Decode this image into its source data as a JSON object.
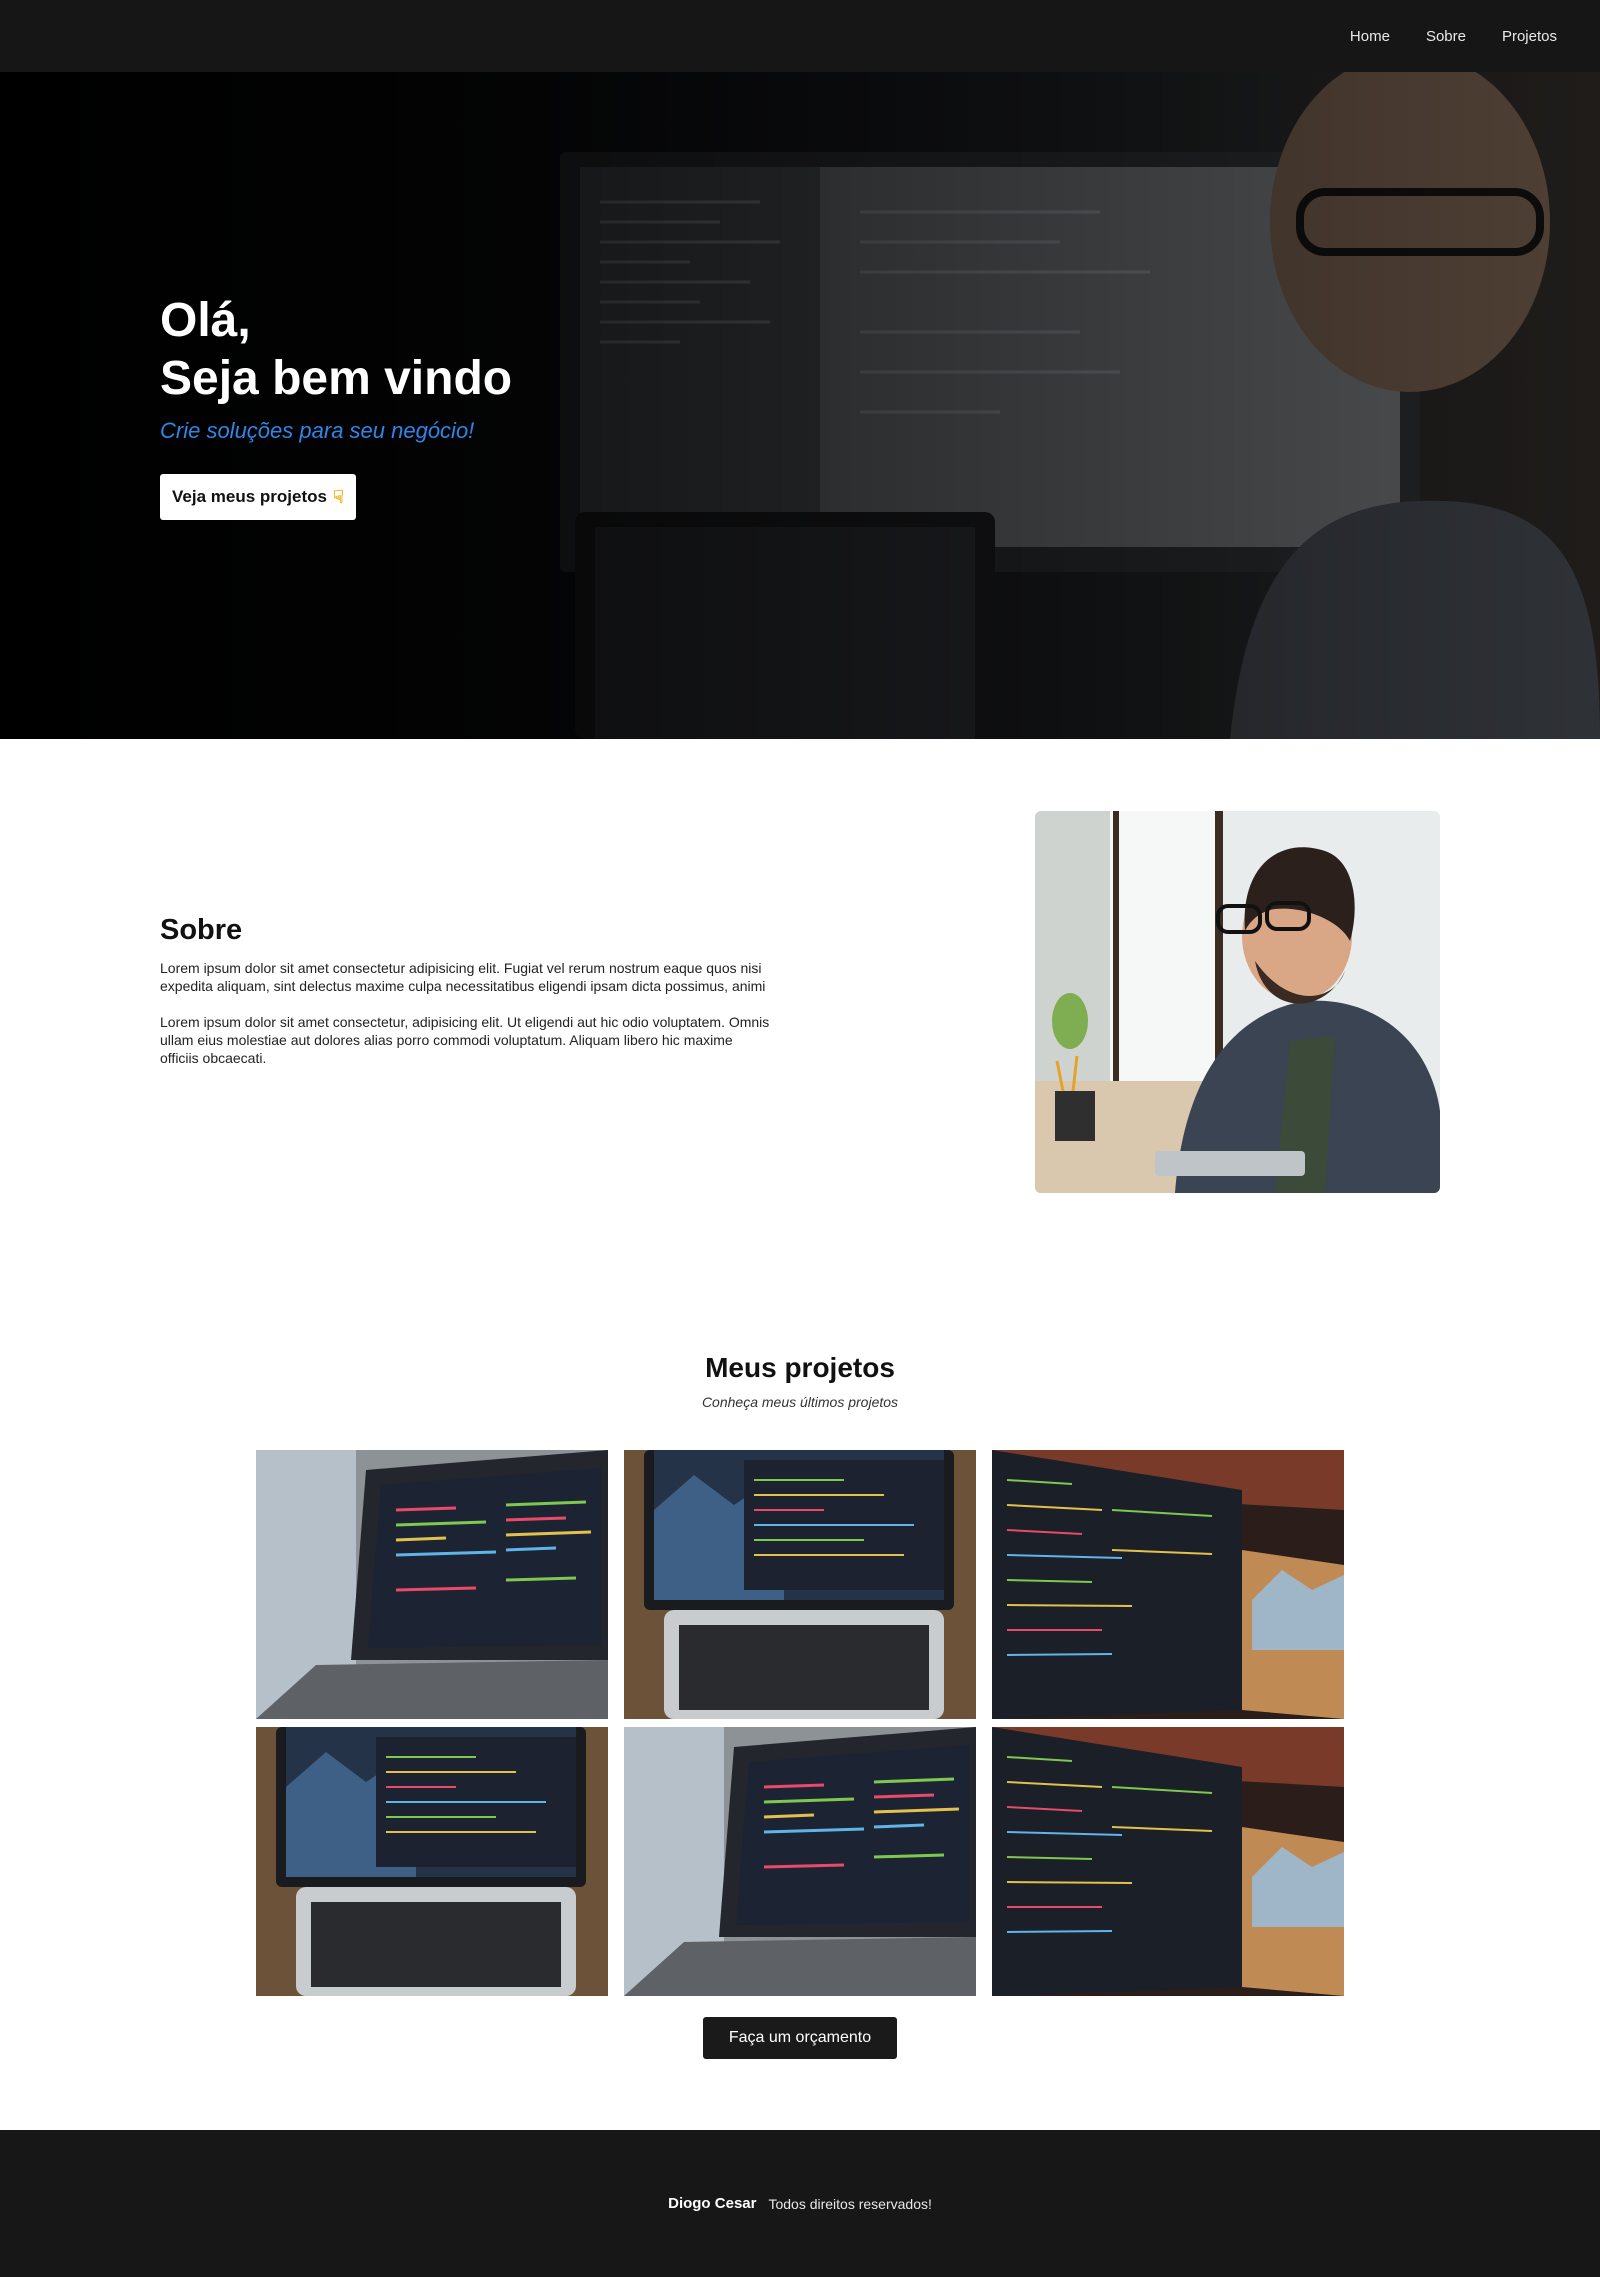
{
  "nav": {
    "items": [
      "Home",
      "Sobre",
      "Projetos"
    ]
  },
  "hero": {
    "greeting": "Olá,",
    "title": "Seja bem vindo",
    "tagline": "Crie soluções para seu negócio!",
    "cta_label": "Veja meus projetos",
    "cta_icon": "pointing-hand-icon"
  },
  "about": {
    "title": "Sobre",
    "paragraphs": [
      "Lorem ipsum dolor sit amet consectetur adipisicing elit. Fugiat vel rerum nostrum eaque quos nisi expedita aliquam, sint delectus maxime culpa necessitatibus eligendi ipsam dicta possimus, animi",
      "Lorem ipsum dolor sit amet consectetur, adipisicing elit. Ut eligendi aut hic odio voluptatem. Omnis ullam eius molestiae aut dolores alias porro commodi voluptatum. Aliquam libero hic maxime officiis obcaecati."
    ]
  },
  "projects": {
    "title": "Meus projetos",
    "subtitle": "Conheça meus últimos projetos",
    "quote_button": "Faça um orçamento"
  },
  "footer": {
    "name": "Diogo Cesar",
    "rights": "Todos direitos reservados!"
  },
  "colors": {
    "nav_bg": "#161616",
    "accent": "#2f86e8",
    "footer_bg": "#171717",
    "button_dark": "#1a1a1a"
  }
}
